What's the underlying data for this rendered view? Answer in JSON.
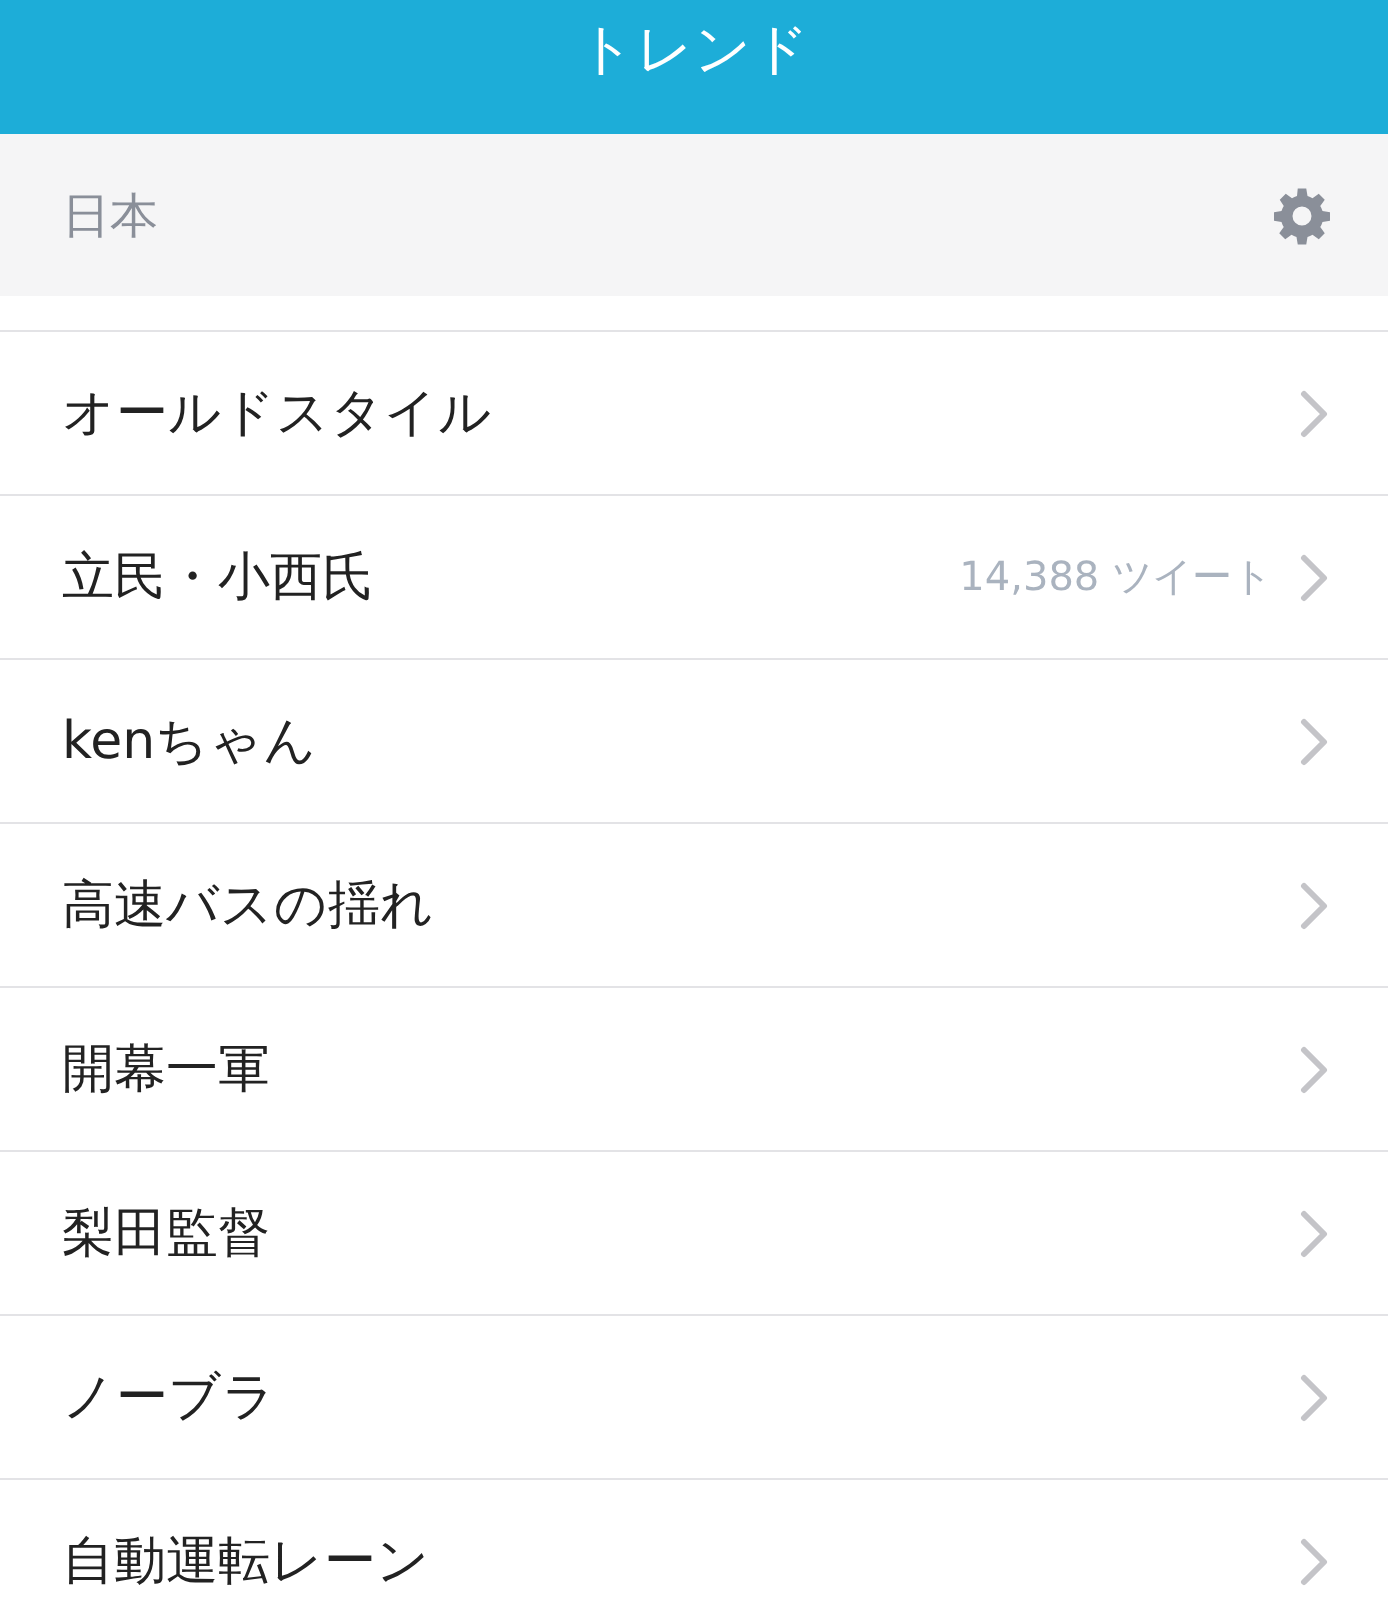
{
  "header": {
    "title": "トレンド"
  },
  "location": {
    "label": "日本"
  },
  "trends": [
    {
      "name": "オールドスタイル"
    },
    {
      "name": "立民・小西氏",
      "count": "14,388 ツイート"
    },
    {
      "name": "kenちゃん"
    },
    {
      "name": "高速バスの揺れ"
    },
    {
      "name": "開幕一軍"
    },
    {
      "name": "梨田監督"
    },
    {
      "name": "ノーブラ"
    },
    {
      "name": "自動運転レーン"
    }
  ]
}
